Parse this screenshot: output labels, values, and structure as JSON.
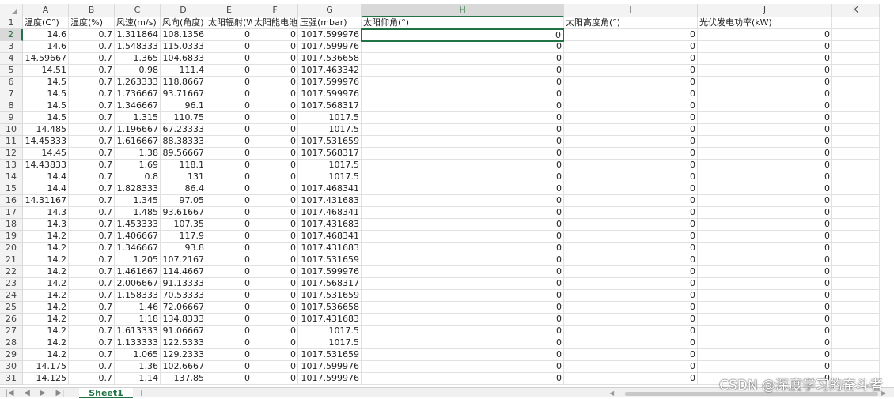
{
  "columns": [
    "A",
    "B",
    "C",
    "D",
    "E",
    "F",
    "G",
    "H",
    "I",
    "J",
    "K"
  ],
  "active_column": "H",
  "active_row": 2,
  "header_row": {
    "number": 1,
    "cells": [
      "温度(C°)",
      "湿度(%)",
      "风速(m/s)",
      "风向(角度)",
      "太阳辐射(W",
      "太阳能电池",
      "压强(mbar)",
      "太阳仰角(°)",
      "太阳高度角(°)",
      "光伏发电功率(kW)",
      ""
    ]
  },
  "rows": [
    {
      "n": 2,
      "a": "14.6",
      "b": "0.7",
      "c": "1.311864",
      "d": "108.1356",
      "g": "1017.599976"
    },
    {
      "n": 3,
      "a": "14.6",
      "b": "0.7",
      "c": "1.548333",
      "d": "115.0333",
      "g": "1017.599976"
    },
    {
      "n": 4,
      "a": "14.59667",
      "b": "0.7",
      "c": "1.365",
      "d": "104.6833",
      "g": "1017.536658"
    },
    {
      "n": 5,
      "a": "14.51",
      "b": "0.7",
      "c": "0.98",
      "d": "111.4",
      "g": "1017.463342"
    },
    {
      "n": 6,
      "a": "14.5",
      "b": "0.7",
      "c": "1.263333",
      "d": "118.8667",
      "g": "1017.599976"
    },
    {
      "n": 7,
      "a": "14.5",
      "b": "0.7",
      "c": "1.736667",
      "d": "93.71667",
      "g": "1017.599976"
    },
    {
      "n": 8,
      "a": "14.5",
      "b": "0.7",
      "c": "1.346667",
      "d": "96.1",
      "g": "1017.568317"
    },
    {
      "n": 9,
      "a": "14.5",
      "b": "0.7",
      "c": "1.315",
      "d": "110.75",
      "g": "1017.5"
    },
    {
      "n": 10,
      "a": "14.485",
      "b": "0.7",
      "c": "1.196667",
      "d": "67.23333",
      "g": "1017.5"
    },
    {
      "n": 11,
      "a": "14.45333",
      "b": "0.7",
      "c": "1.616667",
      "d": "88.38333",
      "g": "1017.531659"
    },
    {
      "n": 12,
      "a": "14.45",
      "b": "0.7",
      "c": "1.38",
      "d": "89.56667",
      "g": "1017.568317"
    },
    {
      "n": 13,
      "a": "14.43833",
      "b": "0.7",
      "c": "1.69",
      "d": "118.1",
      "g": "1017.5"
    },
    {
      "n": 14,
      "a": "14.4",
      "b": "0.7",
      "c": "0.8",
      "d": "131",
      "g": "1017.5"
    },
    {
      "n": 15,
      "a": "14.4",
      "b": "0.7",
      "c": "1.828333",
      "d": "86.4",
      "g": "1017.468341"
    },
    {
      "n": 16,
      "a": "14.31167",
      "b": "0.7",
      "c": "1.345",
      "d": "97.05",
      "g": "1017.431683"
    },
    {
      "n": 17,
      "a": "14.3",
      "b": "0.7",
      "c": "1.485",
      "d": "93.61667",
      "g": "1017.468341"
    },
    {
      "n": 18,
      "a": "14.3",
      "b": "0.7",
      "c": "1.453333",
      "d": "107.35",
      "g": "1017.431683"
    },
    {
      "n": 19,
      "a": "14.2",
      "b": "0.7",
      "c": "1.406667",
      "d": "117.9",
      "g": "1017.468341"
    },
    {
      "n": 20,
      "a": "14.2",
      "b": "0.7",
      "c": "1.346667",
      "d": "93.8",
      "g": "1017.431683"
    },
    {
      "n": 21,
      "a": "14.2",
      "b": "0.7",
      "c": "1.205",
      "d": "107.2167",
      "g": "1017.531659"
    },
    {
      "n": 22,
      "a": "14.2",
      "b": "0.7",
      "c": "1.461667",
      "d": "114.4667",
      "g": "1017.599976"
    },
    {
      "n": 23,
      "a": "14.2",
      "b": "0.7",
      "c": "2.006667",
      "d": "91.13333",
      "g": "1017.568317"
    },
    {
      "n": 24,
      "a": "14.2",
      "b": "0.7",
      "c": "1.158333",
      "d": "70.53333",
      "g": "1017.531659"
    },
    {
      "n": 25,
      "a": "14.2",
      "b": "0.7",
      "c": "1.46",
      "d": "72.06667",
      "g": "1017.536658"
    },
    {
      "n": 26,
      "a": "14.2",
      "b": "0.7",
      "c": "1.18",
      "d": "134.8333",
      "g": "1017.431683"
    },
    {
      "n": 27,
      "a": "14.2",
      "b": "0.7",
      "c": "1.613333",
      "d": "91.06667",
      "g": "1017.5"
    },
    {
      "n": 28,
      "a": "14.2",
      "b": "0.7",
      "c": "1.133333",
      "d": "122.5333",
      "g": "1017.5"
    },
    {
      "n": 29,
      "a": "14.2",
      "b": "0.7",
      "c": "1.065",
      "d": "129.2333",
      "g": "1017.531659"
    },
    {
      "n": 30,
      "a": "14.175",
      "b": "0.7",
      "c": "1.36",
      "d": "102.6667",
      "g": "1017.599976"
    },
    {
      "n": 31,
      "a": "14.125",
      "b": "0.7",
      "c": "1.14",
      "d": "137.85",
      "g": "1017.599976"
    }
  ],
  "zero_value": "0",
  "sheet_tab": {
    "name": "Sheet1",
    "add_label": "+"
  },
  "nav": {
    "first": "|◀",
    "prev": "◀",
    "next": "▶",
    "last": "▶|"
  },
  "scroll_arrows": {
    "left": "◀",
    "right": "▶"
  },
  "watermark": "CSDN @深度学习的奋斗者",
  "colors": {
    "accent": "#217346",
    "header_bg": "#f3f3f3",
    "active_header_bg": "#d9d9d9"
  }
}
